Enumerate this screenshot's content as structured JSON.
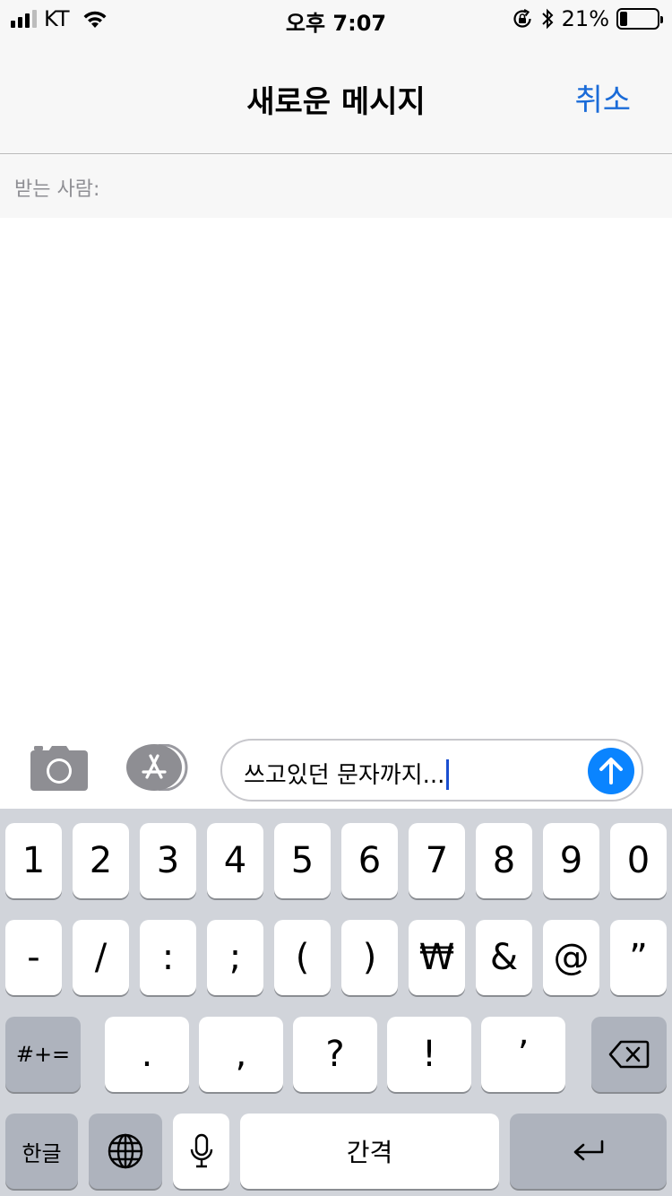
{
  "status_bar": {
    "carrier": "KT",
    "time": "오후 7:07",
    "battery_percent": "21%",
    "battery_level": 0.21
  },
  "nav": {
    "title": "새로운 메시지",
    "cancel_label": "취소"
  },
  "recipient": {
    "label": "받는 사람:"
  },
  "composer": {
    "message_text": "쓰고있던 문자까지...",
    "camera_icon": "camera-icon",
    "apps_icon": "app-store-icon",
    "send_icon": "arrow-up-icon"
  },
  "keyboard": {
    "row1": [
      "1",
      "2",
      "3",
      "4",
      "5",
      "6",
      "7",
      "8",
      "9",
      "0"
    ],
    "row2": [
      "-",
      "/",
      ":",
      ";",
      "(",
      ")",
      "₩",
      "&",
      "@",
      "”"
    ],
    "row3_mode": "#+=",
    "row3": [
      ".",
      ",",
      "?",
      "!",
      "’"
    ],
    "hangul_label": "한글",
    "space_label": "간격",
    "globe_icon": "globe-icon",
    "mic_icon": "microphone-icon",
    "delete_icon": "backspace-icon",
    "return_icon": "return-icon"
  },
  "colors": {
    "accent": "#1a6bd8",
    "send": "#0a84ff",
    "keyboard_bg": "#d1d4da"
  }
}
